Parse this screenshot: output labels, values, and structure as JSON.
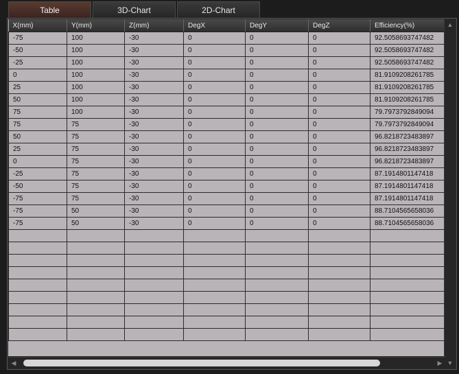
{
  "tabs": [
    {
      "label": "Table"
    },
    {
      "label": "3D-Chart"
    },
    {
      "label": "2D-Chart"
    }
  ],
  "table": {
    "columns": [
      "X(mm)",
      "Y(mm)",
      "Z(mm)",
      "DegX",
      "DegY",
      "DegZ",
      "Efficiency(%)"
    ],
    "rows": [
      [
        "-75",
        "100",
        "-30",
        "0",
        "0",
        "0",
        "92.5058693747482"
      ],
      [
        "-50",
        "100",
        "-30",
        "0",
        "0",
        "0",
        "92.5058693747482"
      ],
      [
        "-25",
        "100",
        "-30",
        "0",
        "0",
        "0",
        "92.5058693747482"
      ],
      [
        "0",
        "100",
        "-30",
        "0",
        "0",
        "0",
        "81.9109208261785"
      ],
      [
        "25",
        "100",
        "-30",
        "0",
        "0",
        "0",
        "81.9109208261785"
      ],
      [
        "50",
        "100",
        "-30",
        "0",
        "0",
        "0",
        "81.9109208261785"
      ],
      [
        "75",
        "100",
        "-30",
        "0",
        "0",
        "0",
        "79.7973792849094"
      ],
      [
        "75",
        "75",
        "-30",
        "0",
        "0",
        "0",
        "79.7973792849094"
      ],
      [
        "50",
        "75",
        "-30",
        "0",
        "0",
        "0",
        "96.8218723483897"
      ],
      [
        "25",
        "75",
        "-30",
        "0",
        "0",
        "0",
        "96.8218723483897"
      ],
      [
        "0",
        "75",
        "-30",
        "0",
        "0",
        "0",
        "96.8218723483897"
      ],
      [
        "-25",
        "75",
        "-30",
        "0",
        "0",
        "0",
        "87.1914801147418"
      ],
      [
        "-50",
        "75",
        "-30",
        "0",
        "0",
        "0",
        "87.1914801147418"
      ],
      [
        "-75",
        "75",
        "-30",
        "0",
        "0",
        "0",
        "87.1914801147418"
      ],
      [
        "-75",
        "50",
        "-30",
        "0",
        "0",
        "0",
        "88.7104565658036"
      ],
      [
        "-75",
        "50",
        "-30",
        "0",
        "0",
        "0",
        "88.7104565658036"
      ]
    ],
    "empty_rows": 9
  },
  "icons": {
    "scroll_up": "▲",
    "scroll_down": "▼",
    "scroll_left": "◀",
    "scroll_right": "▶"
  }
}
